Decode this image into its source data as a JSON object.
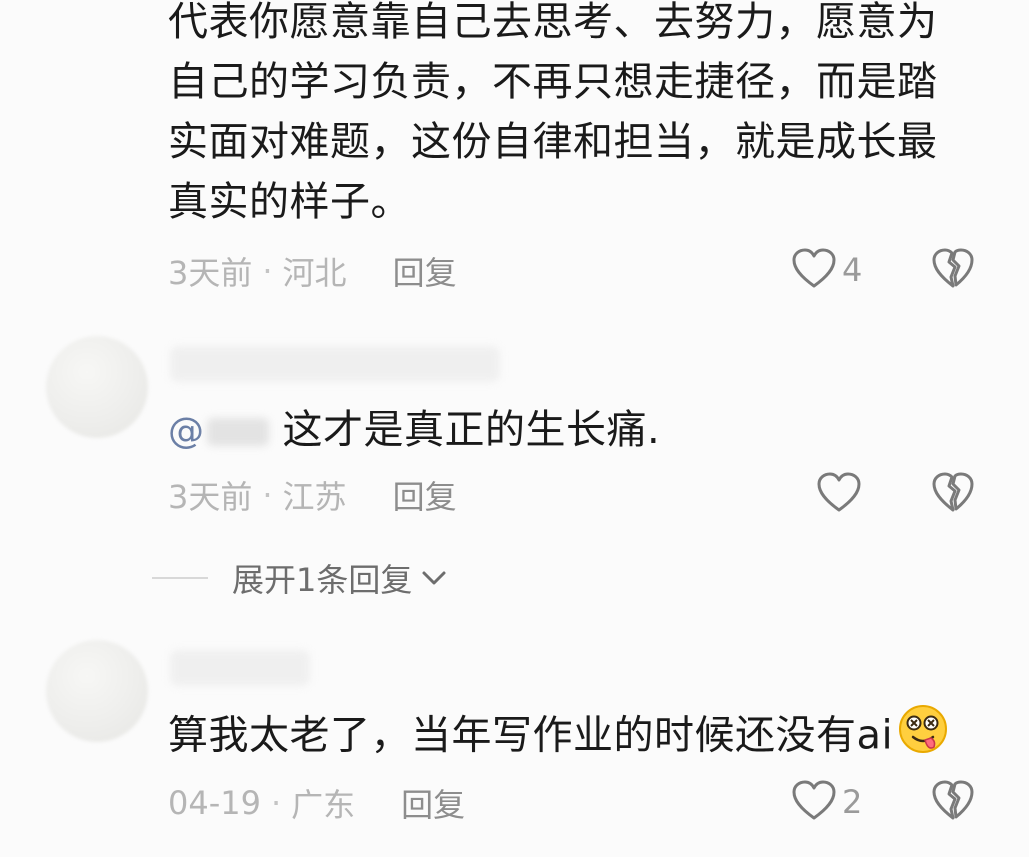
{
  "comments": [
    {
      "text_lines": [
        "代表你愿意靠自己去思考、去努力，愿意为",
        "自己的学习负责，不再只想走捷径，而是踏",
        "实面对难题，这份自律和担当，就是成长最",
        "真实的样子。"
      ],
      "time": "3天前",
      "location": "河北",
      "reply_label": "回复",
      "likes": "4",
      "separator": "·"
    },
    {
      "mention_symbol": "@",
      "text": "这才是真正的生长痛.",
      "time": "3天前",
      "location": "江苏",
      "reply_label": "回复",
      "likes": "",
      "separator": "·",
      "expand_label": "展开1条回复"
    },
    {
      "text": "算我太老了，当年写作业的时候还没有ai",
      "time": "04-19",
      "location": "广东",
      "reply_label": "回复",
      "likes": "2",
      "separator": "·"
    }
  ],
  "colors": {
    "background": "#fbfbfb",
    "text": "#1a1a1a",
    "meta": "#b5b5b5",
    "reply": "#8d8d8d",
    "mention": "#6b7fa6"
  },
  "icons": {
    "like": "heart-outline-icon",
    "dislike": "broken-heart-icon",
    "expand": "chevron-down-icon",
    "emoji": "drooling-dizzy-face-emoji"
  }
}
